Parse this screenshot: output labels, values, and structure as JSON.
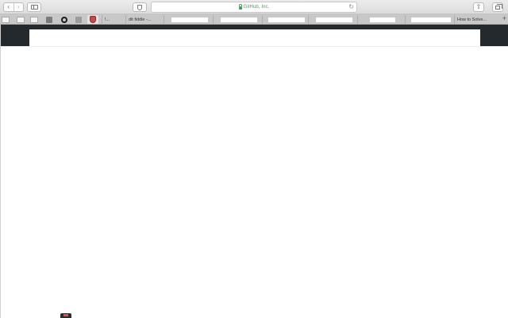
{
  "browser": {
    "address_text": "GitHub, Inc.",
    "accent_color": "#3aa64b",
    "buttons": {
      "back": "back-icon",
      "forward": "forward-icon",
      "sidebar": "sidebar-icon",
      "shield": "shield-icon",
      "reload": "reload-icon",
      "share": "share-icon",
      "tabs": "tabs-icon"
    }
  },
  "tabs": {
    "labeled": [
      {
        "label": "!..."
      },
      {
        "label": "dit fiddle -..."
      },
      {
        "label": ""
      },
      {
        "label": ""
      },
      {
        "label": ""
      },
      {
        "label": ""
      },
      {
        "label": ""
      },
      {
        "label": ""
      },
      {
        "label": "How to Solve..."
      }
    ],
    "new_tab": "+"
  },
  "page": {
    "header_color": "#24292e"
  }
}
